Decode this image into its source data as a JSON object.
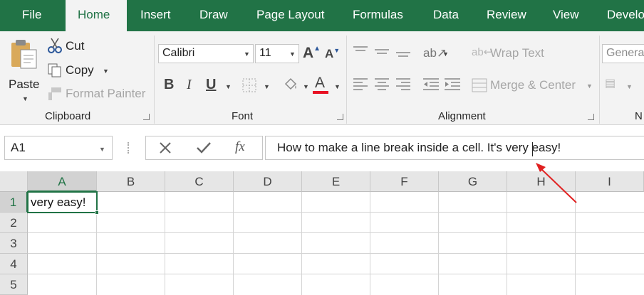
{
  "tabs": [
    "File",
    "Home",
    "Insert",
    "Draw",
    "Page Layout",
    "Formulas",
    "Data",
    "Review",
    "View",
    "Develo"
  ],
  "clipboard": {
    "paste": "Paste",
    "cut": "Cut",
    "copy": "Copy",
    "format_painter": "Format Painter",
    "group_label": "Clipboard"
  },
  "font": {
    "name": "Calibri",
    "size": "11",
    "group_label": "Font"
  },
  "alignment": {
    "wrap_text": "Wrap Text",
    "merge_center": "Merge & Center",
    "group_label": "Alignment"
  },
  "number": {
    "format": "Genera",
    "group_label": "N"
  },
  "formula_bar": {
    "name_box": "A1",
    "fx": "fx",
    "content": "How to make a line break inside a cell. It's very easy!"
  },
  "columns": [
    "A",
    "B",
    "C",
    "D",
    "E",
    "F",
    "G",
    "H",
    "I"
  ],
  "rows": [
    "1",
    "2",
    "3",
    "4",
    "5"
  ],
  "cells": {
    "A1": "very easy!"
  },
  "colors": {
    "brand": "#217346",
    "font_color_bar": "#e81123",
    "annotation_arrow": "#e02020"
  }
}
